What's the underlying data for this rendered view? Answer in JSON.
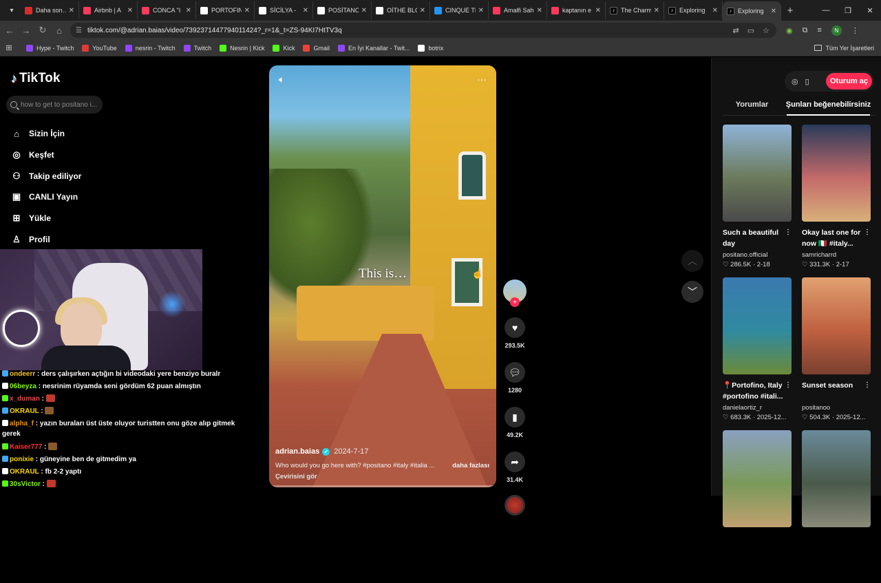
{
  "browser": {
    "tabs": [
      {
        "title": "Daha son…",
        "color": "#d32f2f",
        "icon": "youtube-icon"
      },
      {
        "title": "Airbnb | A",
        "color": "#ff385c",
        "icon": "airbnb-icon"
      },
      {
        "title": "CONCA \"I",
        "color": "#ff385c",
        "icon": "airbnb-icon"
      },
      {
        "title": "PORTOFIN",
        "color": "#ffffff",
        "icon": "google-icon"
      },
      {
        "title": "SİCİLYA -",
        "color": "#ffffff",
        "icon": "google-icon"
      },
      {
        "title": "POSİTANO",
        "color": "#ffffff",
        "icon": "google-icon"
      },
      {
        "title": "OİTHE BLO",
        "color": "#ffffff",
        "icon": "google-icon"
      },
      {
        "title": "CINQUE TE",
        "color": "#2196f3",
        "icon": "globe-icon"
      },
      {
        "title": "Amalfi Sah",
        "color": "#ff385c",
        "icon": "airbnb-icon"
      },
      {
        "title": "kaptanın e",
        "color": "#ff385c",
        "icon": "airbnb-icon"
      },
      {
        "title": "The Charm",
        "color": "#000000",
        "icon": "tiktok-icon"
      },
      {
        "title": "Exploring",
        "color": "#000000",
        "icon": "tiktok-icon"
      },
      {
        "title": "Exploring",
        "color": "#000000",
        "icon": "tiktok-icon"
      }
    ],
    "url": "tiktok.com/@adrian.baias/video/7392371447794011424?_r=1&_t=ZS-94KI7HtTV3q",
    "bookmarks": [
      {
        "label": "Hype - Twitch",
        "color": "#9146ff"
      },
      {
        "label": "YouTube",
        "color": "#e53935"
      },
      {
        "label": "nesrin - Twitch",
        "color": "#9146ff"
      },
      {
        "label": "Twitch",
        "color": "#9146ff"
      },
      {
        "label": "Nesrin | Kick",
        "color": "#53fc18"
      },
      {
        "label": "Kick",
        "color": "#53fc18"
      },
      {
        "label": "Gmail",
        "color": "#ea4335"
      },
      {
        "label": "En İyi Kanallar - Twit...",
        "color": "#9146ff"
      },
      {
        "label": "botrix",
        "color": "#ffffff"
      }
    ],
    "all_bookmarks": "Tüm Yer İşaretleri",
    "profile_initial": "N"
  },
  "tiktok": {
    "logo": "TikTok",
    "search_placeholder": "how to get to positano i...",
    "nav": [
      {
        "label": "Sizin İçin",
        "icon": "home-icon",
        "glyph": "⌂"
      },
      {
        "label": "Keşfet",
        "icon": "compass-icon",
        "glyph": "◎"
      },
      {
        "label": "Takip ediliyor",
        "icon": "following-icon",
        "glyph": "⚇"
      },
      {
        "label": "CANLI Yayın",
        "icon": "live-icon",
        "glyph": "▣"
      },
      {
        "label": "Yükle",
        "icon": "upload-icon",
        "glyph": "⊞"
      },
      {
        "label": "Profil",
        "icon": "profile-icon",
        "glyph": "♙"
      }
    ],
    "video": {
      "overlay_text": "This is…",
      "author": "adrian.baias",
      "date": "2024-7-17",
      "description": "Who would you go here with? #positano #italy #italia ...",
      "more": "daha fazlası",
      "translate": "Çevirisini gör"
    },
    "actions": {
      "likes": "293.5K",
      "comments": "1280",
      "saves": "49.2K",
      "shares": "31.4K"
    },
    "right_panel": {
      "login": "Oturum aç",
      "tabs": [
        "Yorumlar",
        "Şunları beğenebilirsiniz"
      ],
      "cards": [
        {
          "title": "Such a beautiful day",
          "user": "positano.official",
          "likes": "286.5K",
          "date": "2-18",
          "colors": [
            "#8fb3d8",
            "#6b7a5a",
            "#4a4a4a"
          ]
        },
        {
          "title": "Okay last one for now 🇮🇹 #italy...",
          "user": "samricharrd",
          "likes": "331.3K",
          "date": "2-17",
          "colors": [
            "#2a3a5a",
            "#c46a6a",
            "#d8b07a"
          ]
        },
        {
          "title": "📍Portofino, Italy #portofino #itali...",
          "user": "danielaortiz_r",
          "likes": "683.3K",
          "date": "2025-12...",
          "colors": [
            "#3a7ab0",
            "#2f8aa0",
            "#6b8a3a"
          ]
        },
        {
          "title": "Sunset season",
          "user": "positanoo",
          "likes": "504.3K",
          "date": "2025-12...",
          "colors": [
            "#e0a070",
            "#c06040",
            "#7a4030"
          ]
        },
        {
          "title": "",
          "user": "",
          "likes": "",
          "date": "",
          "colors": [
            "#8aa0c0",
            "#7a9a5a",
            "#c0a070"
          ]
        },
        {
          "title": "",
          "user": "",
          "likes": "",
          "date": "",
          "colors": [
            "#6a8a9a",
            "#4a5a4a",
            "#8a8a7a"
          ]
        }
      ]
    }
  },
  "stream": {
    "chat": [
      {
        "user": "ondeerr",
        "user_color": "#f5c518",
        "text": "ders çalışırken açtığın bi videodaki yere benziyo buralr"
      },
      {
        "user": "06beyza",
        "user_color": "#7cfc00",
        "text": "nesrinim rüyamda seni gördüm 62 puan almıştın"
      },
      {
        "user": "x_duman",
        "user_color": "#ff4040",
        "text": ""
      },
      {
        "user": "OKRAUL",
        "user_color": "#ffd700",
        "text": ""
      },
      {
        "user": "alpha_f",
        "user_color": "#ff8c00",
        "text": "yazın buraları üst üste oluyor turistten onu göze alıp gitmek gerek"
      },
      {
        "user": "Kaiser777",
        "user_color": "#ff3030",
        "text": ""
      },
      {
        "user": "ponixie",
        "user_color": "#ffd700",
        "text": "güneyine ben de gitmedim ya"
      },
      {
        "user": "OKRAUL",
        "user_color": "#ffd700",
        "text": "fb 2-2 yaptı"
      },
      {
        "user": "30sVictor",
        "user_color": "#7cfc00",
        "text": ""
      }
    ]
  }
}
